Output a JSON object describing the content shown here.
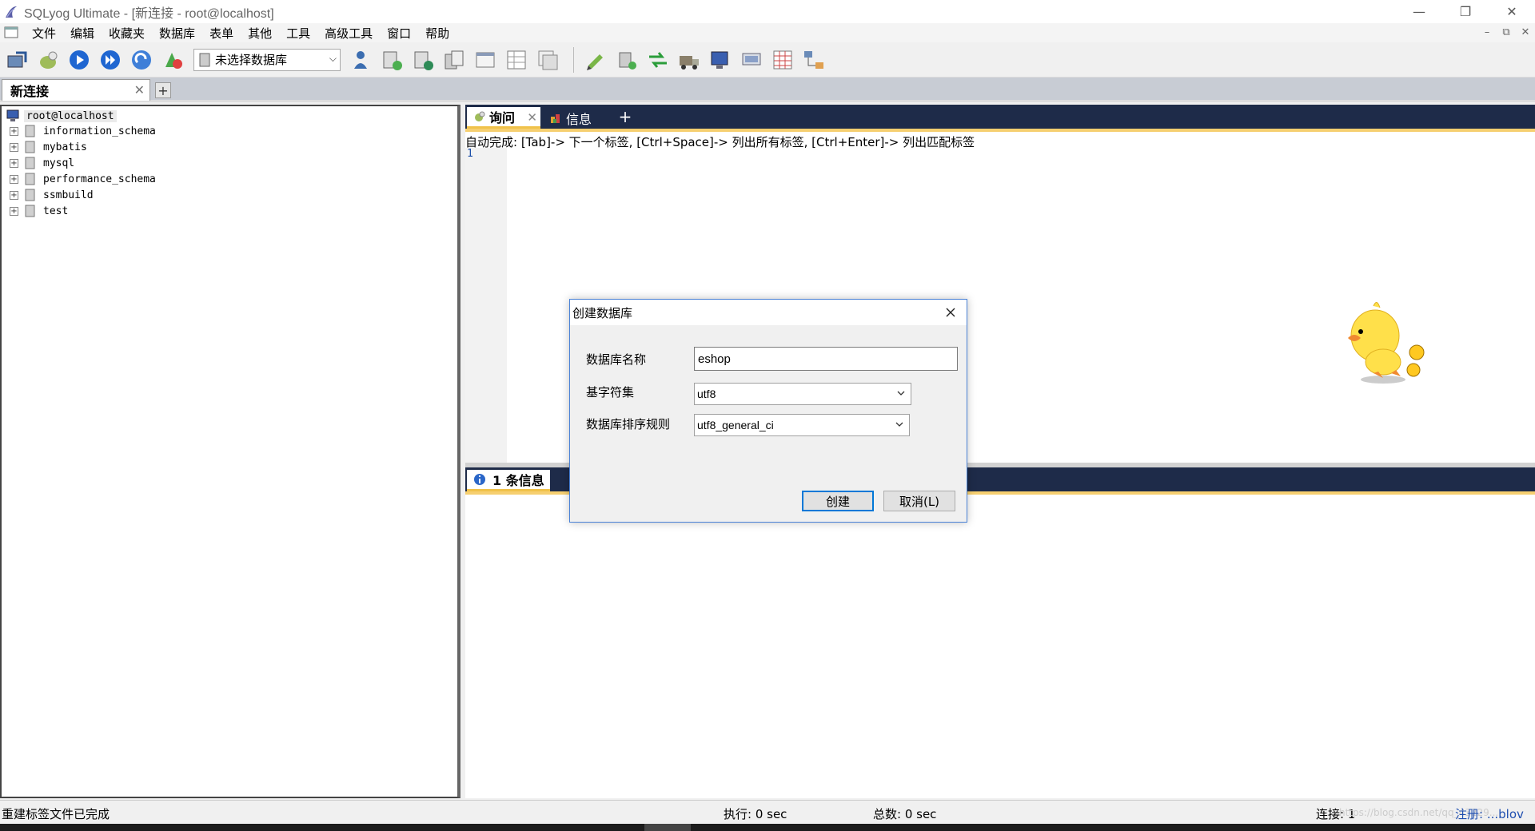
{
  "window": {
    "title": "SQLyog Ultimate - [新连接 - root@localhost]",
    "minimize": "—",
    "restore": "❐",
    "close": "✕"
  },
  "menu": {
    "items": [
      "文件",
      "编辑",
      "收藏夹",
      "数据库",
      "表单",
      "其他",
      "工具",
      "高级工具",
      "窗口",
      "帮助"
    ],
    "mdi_min": "–",
    "mdi_restore": "⧉",
    "mdi_close": "✕"
  },
  "toolbar": {
    "db_select": "未选择数据库"
  },
  "connection_tab": {
    "label": "新连接",
    "close": "✕",
    "add": "+"
  },
  "tree": {
    "root": "root@localhost",
    "databases": [
      "information_schema",
      "mybatis",
      "mysql",
      "performance_schema",
      "ssmbuild",
      "test"
    ]
  },
  "query_tabs": {
    "query": "询问",
    "info": "信息",
    "close": "✕",
    "add": "+"
  },
  "editor": {
    "autocomplete_hint": "自动完成: [Tab]-> 下一个标签, [Ctrl+Space]-> 列出所有标签, [Ctrl+Enter]-> 列出匹配标签",
    "line_number": "1"
  },
  "results": {
    "tab_label": "1 条信息"
  },
  "status": {
    "message": "重建标签文件已完成",
    "exec": "执行: 0 sec",
    "total": "总数: 0 sec",
    "connection": "连接: 1",
    "watermark": "https://blog.csdn.net/qq_43229...",
    "register": "注册: ...blov"
  },
  "dialog": {
    "title": "创建数据库",
    "db_name_label": "数据库名称",
    "db_name_value": "eshop",
    "charset_label": "基字符集",
    "charset_value": "utf8",
    "collation_label": "数据库排序规则",
    "collation_value": "utf8_general_ci",
    "create_button": "创建",
    "cancel_button": "取消(L)"
  },
  "colors": {
    "tab_strip": "#1e2b49",
    "accent_gold": "#f6cf70",
    "dialog_border": "#4a82d6",
    "line_number": "#1a4da8"
  }
}
